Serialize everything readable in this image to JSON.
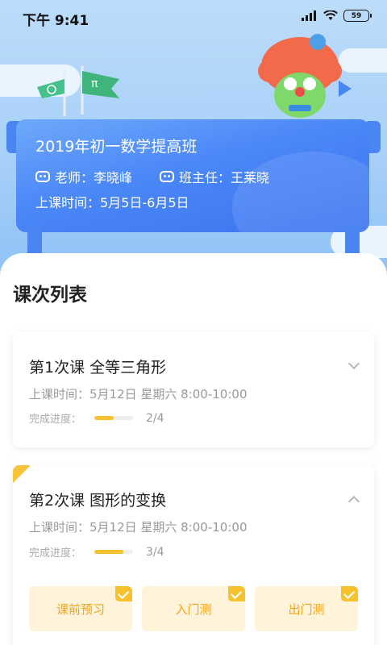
{
  "status_bar": {
    "time": "下午 9:41",
    "battery": "59"
  },
  "class_info": {
    "title": "2019年初一数学提高班",
    "teacher_label": "老师：李晓峰",
    "head_teacher_label": "班主任：王莱晓",
    "schedule": "上课时间：5月5日-6月5日"
  },
  "section_title": "课次列表",
  "lessons": [
    {
      "title": "第1次课  全等三角形",
      "time": "上课时间：5月12日  星期六  8:00-10:00",
      "progress_label": "完成进度：",
      "progress_text": "2/4",
      "progress_fraction": 0.5,
      "expanded": false
    },
    {
      "title": "第2次课  图形的变换",
      "time": "上课时间：5月12日  星期六  8:00-10:00",
      "progress_label": "完成进度：",
      "progress_text": "3/4",
      "progress_fraction": 0.75,
      "expanded": true,
      "tasks": [
        {
          "label": "课前预习",
          "completed": true
        },
        {
          "label": "入门测",
          "completed": true
        },
        {
          "label": "出门测",
          "completed": true
        }
      ]
    }
  ],
  "colors": {
    "accent_yellow": "#f7c12d",
    "board_blue": "#4a87f7",
    "task_bg": "#fff3da",
    "task_text": "#f2a51a"
  },
  "icons": {
    "signal": "signal-icon",
    "wifi": "wifi-icon",
    "battery": "battery-icon",
    "teacher": "robot-icon",
    "expand": "chevron-down-icon",
    "collapse": "chevron-up-icon",
    "done": "checkmark-icon"
  }
}
